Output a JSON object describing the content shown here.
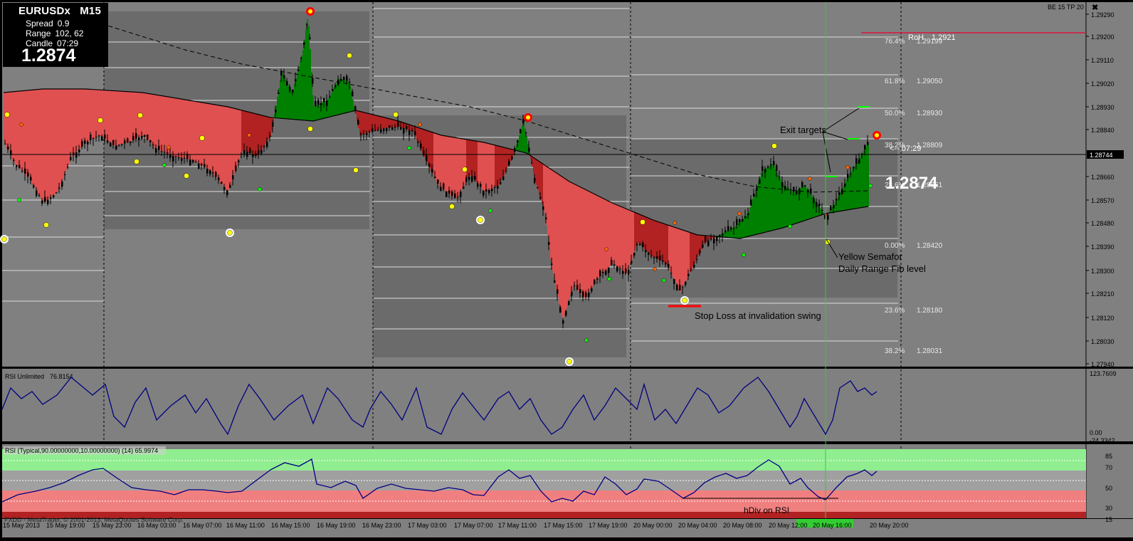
{
  "window": {
    "symbol": "EURUSDx",
    "timeframe": "M15",
    "spread_label": "Spread",
    "spread_value": "0.9",
    "range_label": "Range",
    "range_value": "102, 62",
    "candle_label": "Candle",
    "candle_value": "07:29",
    "price": "1.2874",
    "be_tp": "BE 15  TP 20",
    "close_glyph": "✖",
    "corner_glyph": "▼"
  },
  "main_chart": {
    "big_price": "1.2874",
    "current_price_tag": "1.28744",
    "candle_timer": "<-- 07:29",
    "price_axis": [
      "1.29290",
      "1.29200",
      "1.29110",
      "1.29020",
      "1.28930",
      "1.28840",
      "1.28744",
      "1.28660",
      "1.28570",
      "1.28480",
      "1.28390",
      "1.28300",
      "1.28210",
      "1.28120",
      "1.28030",
      "1.27940"
    ],
    "fib_levels": [
      {
        "pct": "76.4%",
        "price": "1.29199"
      },
      {
        "pct": "61.8%",
        "price": "1.29050"
      },
      {
        "pct": "50.0%",
        "price": "1.28930"
      },
      {
        "pct": "38.2%",
        "price": "1.28809"
      },
      {
        "pct": "23.6%",
        "price": "1.28661"
      },
      {
        "pct": "0.00%",
        "price": "1.28420"
      },
      {
        "pct": "23.6%",
        "price": "1.28180"
      },
      {
        "pct": "38.2%",
        "price": "1.28031"
      }
    ],
    "rh_label": "RoH",
    "rh_value": "1.2921",
    "annotations": {
      "exit_targets": "Exit targets",
      "semafor_line1": "Yellow Semafor",
      "semafor_line2": "Daily Range Fib level",
      "stop_loss": "Stop Loss at invalidation swing"
    },
    "colors": {
      "bull": "#008000",
      "bear": "#b22222",
      "bear_light": "#e05050",
      "semafor": "#ffff00",
      "bg": "#808080",
      "box": "#696969"
    }
  },
  "rsi1": {
    "title": "RSI Unlimited",
    "value": "76.8154",
    "axis": [
      "123.7609",
      "0.00",
      "-24.3342"
    ]
  },
  "rsi2": {
    "title": "RSI (Typical,90.00000000,10.00000000) (14) 65.9974",
    "axis": [
      "85",
      "70",
      "50",
      "30",
      "15"
    ],
    "annotation": "hDiv on RSI",
    "copyright": "FXDD - MetaTrader, © 2001-2013, MetaQuotes Software Corp."
  },
  "time_axis": [
    "15 May 2013",
    "15 May 19:00",
    "15 May 23:00",
    "16 May 03:00",
    "16 May 07:00",
    "16 May 11:00",
    "16 May 15:00",
    "16 May 19:00",
    "16 May 23:00",
    "17 May 03:00",
    "17 May 07:00",
    "17 May 11:00",
    "17 May 15:00",
    "17 May 19:00",
    "20 May 00:00",
    "20 May 04:00",
    "20 May 08:00",
    "20 May 12:00",
    "20 May 16:00",
    "20 May 20:00"
  ]
}
